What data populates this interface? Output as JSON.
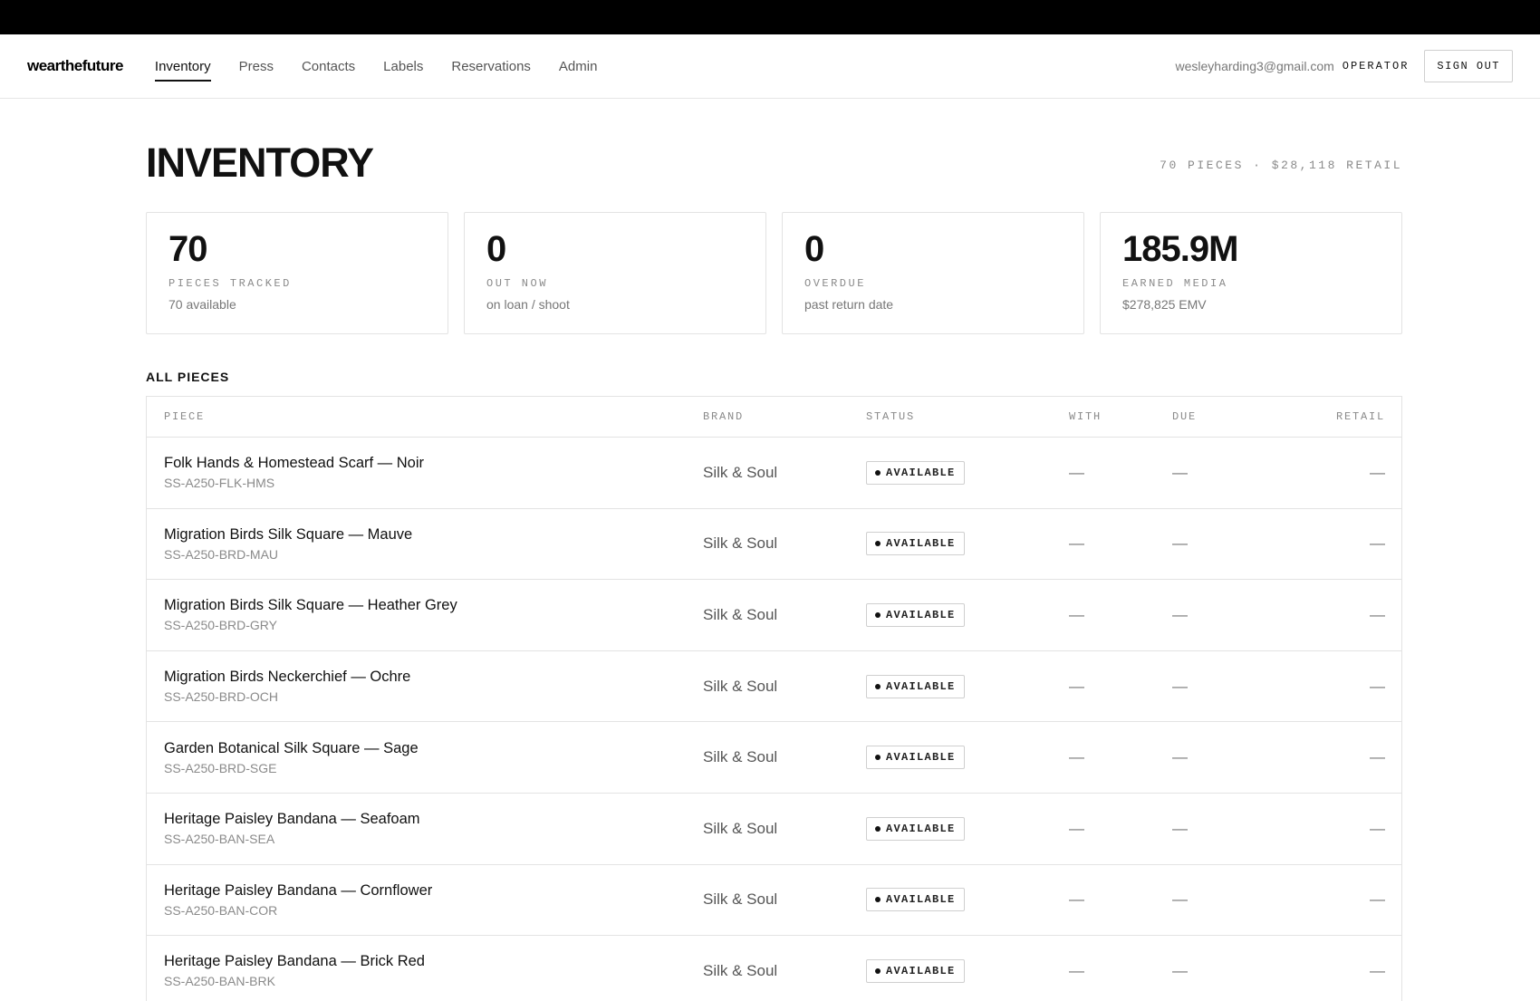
{
  "app": {
    "logo": "wearthefuture",
    "nav": [
      {
        "label": "Inventory",
        "active": true
      },
      {
        "label": "Press",
        "active": false
      },
      {
        "label": "Contacts",
        "active": false
      },
      {
        "label": "Labels",
        "active": false
      },
      {
        "label": "Reservations",
        "active": false
      },
      {
        "label": "Admin",
        "active": false
      }
    ],
    "user_email": "wesleyharding3@gmail.com",
    "user_role": "OPERATOR",
    "sign_out_label": "SIGN OUT"
  },
  "page": {
    "title": "INVENTORY",
    "summary": "70 PIECES · $28,118 RETAIL"
  },
  "stats": [
    {
      "value": "70",
      "label": "PIECES TRACKED",
      "sub": "70 available"
    },
    {
      "value": "0",
      "label": "OUT NOW",
      "sub": "on loan / shoot"
    },
    {
      "value": "0",
      "label": "OVERDUE",
      "sub": "past return date"
    },
    {
      "value": "185.9M",
      "label": "EARNED MEDIA",
      "sub": "$278,825 EMV"
    }
  ],
  "table": {
    "section_title": "ALL PIECES",
    "headers": {
      "piece": "PIECE",
      "brand": "BRAND",
      "status": "STATUS",
      "with": "WITH",
      "due": "DUE",
      "retail": "RETAIL"
    },
    "rows": [
      {
        "name": "Folk Hands & Homestead Scarf — Noir",
        "sku": "SS-A250-FLK-HMS",
        "brand": "Silk & Soul",
        "status": "AVAILABLE",
        "with": "—",
        "due": "—",
        "retail": "—"
      },
      {
        "name": "Migration Birds Silk Square — Mauve",
        "sku": "SS-A250-BRD-MAU",
        "brand": "Silk & Soul",
        "status": "AVAILABLE",
        "with": "—",
        "due": "—",
        "retail": "—"
      },
      {
        "name": "Migration Birds Silk Square — Heather Grey",
        "sku": "SS-A250-BRD-GRY",
        "brand": "Silk & Soul",
        "status": "AVAILABLE",
        "with": "—",
        "due": "—",
        "retail": "—"
      },
      {
        "name": "Migration Birds Neckerchief — Ochre",
        "sku": "SS-A250-BRD-OCH",
        "brand": "Silk & Soul",
        "status": "AVAILABLE",
        "with": "—",
        "due": "—",
        "retail": "—"
      },
      {
        "name": "Garden Botanical Silk Square — Sage",
        "sku": "SS-A250-BRD-SGE",
        "brand": "Silk & Soul",
        "status": "AVAILABLE",
        "with": "—",
        "due": "—",
        "retail": "—"
      },
      {
        "name": "Heritage Paisley Bandana — Seafoam",
        "sku": "SS-A250-BAN-SEA",
        "brand": "Silk & Soul",
        "status": "AVAILABLE",
        "with": "—",
        "due": "—",
        "retail": "—"
      },
      {
        "name": "Heritage Paisley Bandana — Cornflower",
        "sku": "SS-A250-BAN-COR",
        "brand": "Silk & Soul",
        "status": "AVAILABLE",
        "with": "—",
        "due": "—",
        "retail": "—"
      },
      {
        "name": "Heritage Paisley Bandana — Brick Red",
        "sku": "SS-A250-BAN-BRK",
        "brand": "Silk & Soul",
        "status": "AVAILABLE",
        "with": "—",
        "due": "—",
        "retail": "—"
      }
    ]
  }
}
